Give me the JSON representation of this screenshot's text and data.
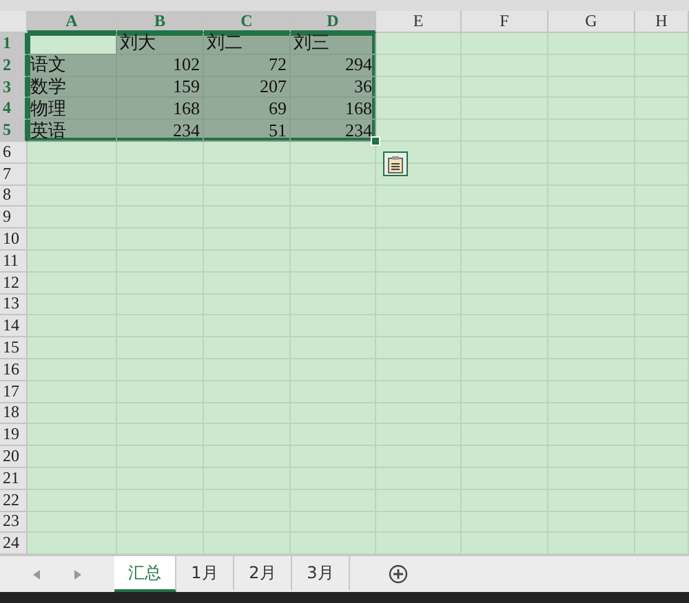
{
  "columns": [
    {
      "label": "A",
      "selected": true
    },
    {
      "label": "B",
      "selected": true
    },
    {
      "label": "C",
      "selected": true
    },
    {
      "label": "D",
      "selected": true
    },
    {
      "label": "E",
      "selected": false
    },
    {
      "label": "F",
      "selected": false
    },
    {
      "label": "G",
      "selected": false
    },
    {
      "label": "H",
      "selected": false
    }
  ],
  "rows": [
    {
      "header": "1",
      "selected": true,
      "cells": [
        {
          "active": true
        },
        {
          "text": "刘大",
          "kind": "text",
          "active": false
        },
        {
          "text": "刘二",
          "kind": "text",
          "active": false
        },
        {
          "text": "刘三",
          "kind": "text",
          "active": false
        }
      ]
    },
    {
      "header": "2",
      "selected": true,
      "cells": [
        {
          "text": "语文",
          "kind": "text",
          "active": false
        },
        {
          "text": "102",
          "kind": "number",
          "active": false
        },
        {
          "text": "72",
          "kind": "number",
          "active": false
        },
        {
          "text": "294",
          "kind": "number",
          "active": false
        }
      ]
    },
    {
      "header": "3",
      "selected": true,
      "cells": [
        {
          "text": "数学",
          "kind": "text",
          "active": false
        },
        {
          "text": "159",
          "kind": "number",
          "active": false
        },
        {
          "text": "207",
          "kind": "number",
          "active": false
        },
        {
          "text": "36",
          "kind": "number",
          "active": false
        }
      ]
    },
    {
      "header": "4",
      "selected": true,
      "cells": [
        {
          "text": "物理",
          "kind": "text",
          "active": false
        },
        {
          "text": "168",
          "kind": "number",
          "active": false
        },
        {
          "text": "69",
          "kind": "number",
          "active": false
        },
        {
          "text": "168",
          "kind": "number",
          "active": false
        }
      ]
    },
    {
      "header": "5",
      "selected": true,
      "cells": [
        {
          "text": "英语",
          "kind": "text",
          "active": false
        },
        {
          "text": "234",
          "kind": "number",
          "active": false
        },
        {
          "text": "51",
          "kind": "number",
          "active": false
        },
        {
          "text": "234",
          "kind": "number",
          "active": false
        }
      ]
    },
    {
      "header": "6",
      "selected": false,
      "cells": []
    },
    {
      "header": "7",
      "selected": false,
      "cells": []
    },
    {
      "header": "8",
      "selected": false,
      "cells": []
    },
    {
      "header": "9",
      "selected": false,
      "cells": []
    },
    {
      "header": "10",
      "selected": false,
      "cells": []
    },
    {
      "header": "11",
      "selected": false,
      "cells": []
    },
    {
      "header": "12",
      "selected": false,
      "cells": []
    },
    {
      "header": "13",
      "selected": false,
      "cells": []
    },
    {
      "header": "14",
      "selected": false,
      "cells": []
    },
    {
      "header": "15",
      "selected": false,
      "cells": []
    },
    {
      "header": "16",
      "selected": false,
      "cells": []
    },
    {
      "header": "17",
      "selected": false,
      "cells": []
    },
    {
      "header": "18",
      "selected": false,
      "cells": []
    },
    {
      "header": "19",
      "selected": false,
      "cells": []
    },
    {
      "header": "20",
      "selected": false,
      "cells": []
    },
    {
      "header": "21",
      "selected": false,
      "cells": []
    },
    {
      "header": "22",
      "selected": false,
      "cells": []
    },
    {
      "header": "23",
      "selected": false,
      "cells": []
    },
    {
      "header": "24",
      "selected": false,
      "cells": []
    }
  ],
  "paste_options": {
    "shown": true
  },
  "sheet_tabs": [
    {
      "label": "汇总",
      "selected": true
    },
    {
      "label": "1月",
      "selected": false
    },
    {
      "label": "2月",
      "selected": false
    },
    {
      "label": "3月",
      "selected": false
    }
  ]
}
